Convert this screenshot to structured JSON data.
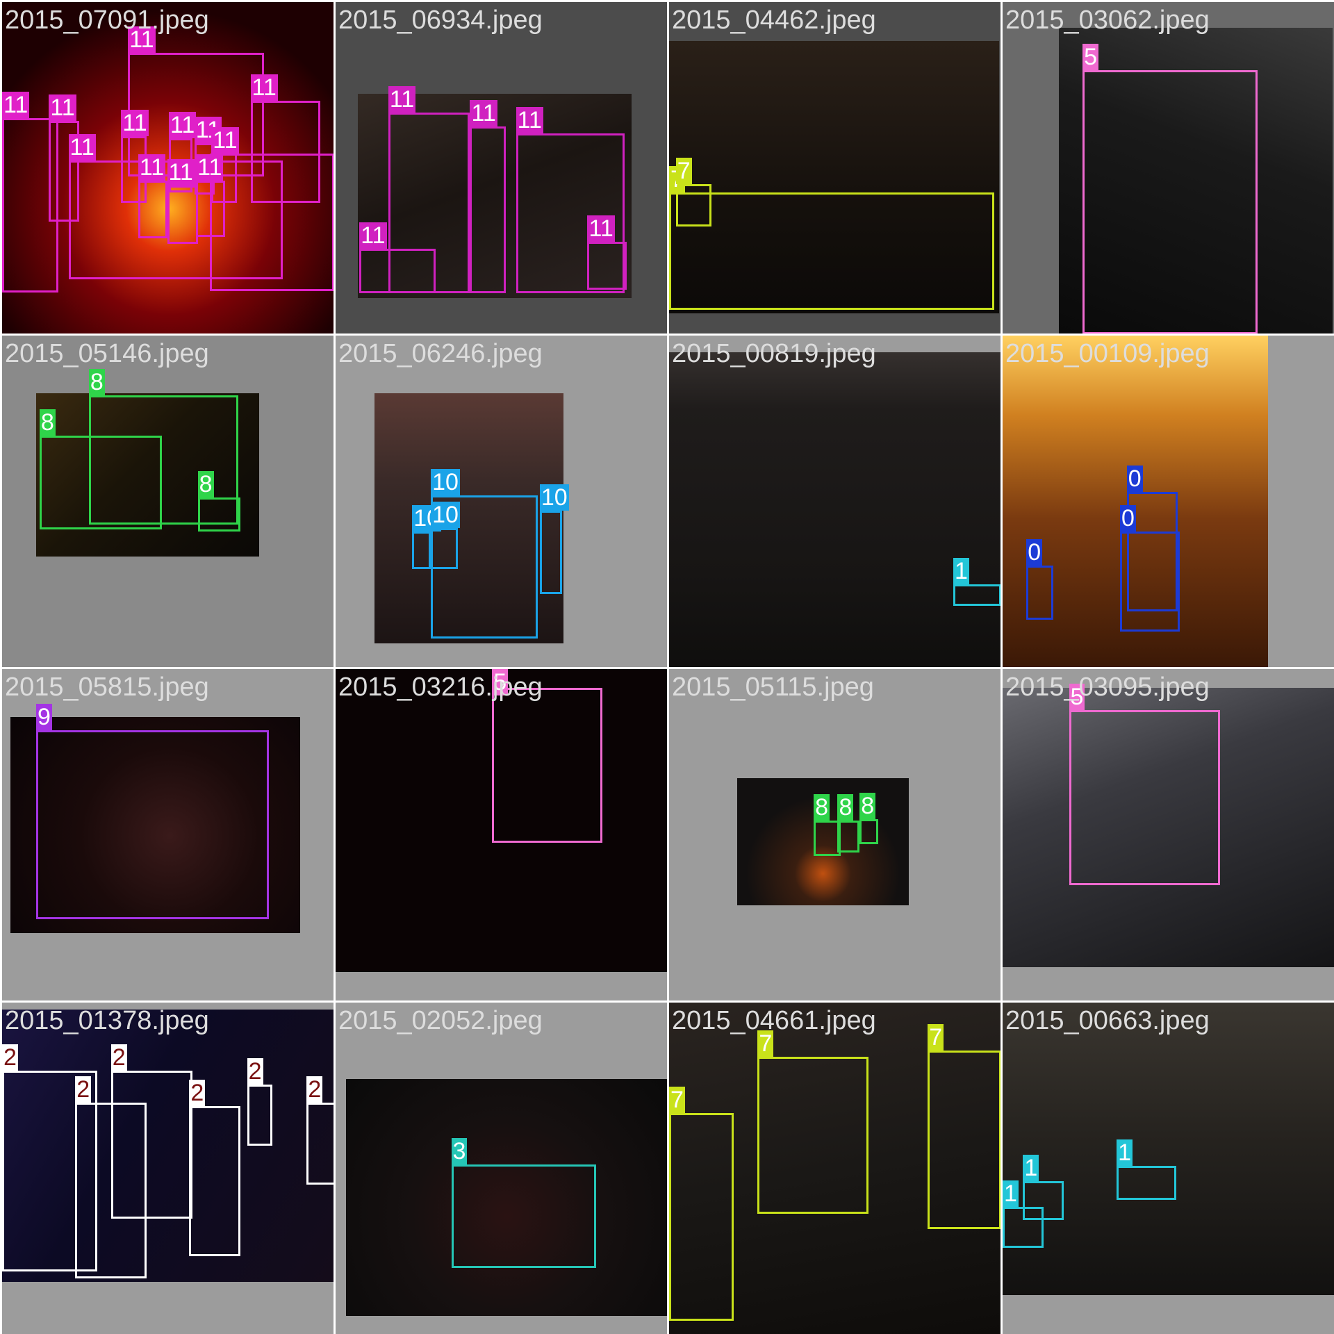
{
  "tiles": [
    {
      "filename": "2015_07091.jpeg",
      "bg": "#9a9a9a",
      "photo": {
        "bg": "radial-gradient(circle at 50% 62%, #ffb020 0%, #e03008 16%, #7a0206 40%, #1e0002 75%)"
      },
      "boxes": [
        {
          "l": 148,
          "t": 60,
          "w": 160,
          "h": 145,
          "label": "11",
          "color": "#e020c8",
          "text": "#ffffff"
        },
        {
          "l": 0,
          "t": 136,
          "w": 66,
          "h": 205,
          "label": "11",
          "color": "#e020c8",
          "text": "#ffffff"
        },
        {
          "l": 55,
          "t": 140,
          "w": 36,
          "h": 118,
          "label": "11",
          "color": "#e020c8",
          "text": "#ffffff"
        },
        {
          "l": 292,
          "t": 116,
          "w": 82,
          "h": 120,
          "label": "11",
          "color": "#e020c8",
          "text": "#ffffff"
        },
        {
          "l": 140,
          "t": 158,
          "w": 30,
          "h": 78,
          "label": "11",
          "color": "#e020c8",
          "text": "#ffffff"
        },
        {
          "l": 196,
          "t": 160,
          "w": 28,
          "h": 64,
          "label": "11",
          "color": "#e020c8",
          "text": "#ffffff"
        },
        {
          "l": 226,
          "t": 166,
          "w": 24,
          "h": 60,
          "label": "11",
          "color": "#e020c8",
          "text": "#ffffff"
        },
        {
          "l": 246,
          "t": 178,
          "w": 30,
          "h": 58,
          "label": "11",
          "color": "#e020c8",
          "text": "#ffffff"
        },
        {
          "l": 78,
          "t": 186,
          "w": 252,
          "h": 140,
          "label": "11",
          "color": "#e020c8",
          "text": "#ffffff"
        },
        {
          "l": 160,
          "t": 210,
          "w": 34,
          "h": 68,
          "label": "11",
          "color": "#e020c8",
          "text": "#ffffff"
        },
        {
          "l": 194,
          "t": 216,
          "w": 36,
          "h": 68,
          "label": "11",
          "color": "#e020c8",
          "text": "#ffffff"
        },
        {
          "l": 228,
          "t": 210,
          "w": 34,
          "h": 66,
          "label": "11",
          "color": "#e020c8",
          "text": "#ffffff"
        },
        {
          "l": 244,
          "t": 178,
          "w": 146,
          "h": 162,
          "label": "",
          "color": "#e020c8",
          "text": "#ffffff"
        }
      ]
    },
    {
      "filename": "2015_06934.jpeg",
      "bg": "#4c4c4c",
      "photo": {
        "l": 26,
        "t": 108,
        "w": 322,
        "h": 240,
        "bg": "linear-gradient(160deg, #342a24 0%, #1b1512 45%, #2a2220 100%)"
      },
      "boxes": [
        {
          "l": 62,
          "t": 130,
          "w": 96,
          "h": 212,
          "label": "11",
          "color": "#d021c0",
          "text": "#ffffff"
        },
        {
          "l": 158,
          "t": 146,
          "w": 42,
          "h": 196,
          "label": "11",
          "color": "#d021c0",
          "text": "#ffffff"
        },
        {
          "l": 212,
          "t": 154,
          "w": 128,
          "h": 188,
          "label": "11",
          "color": "#d021c0",
          "text": "#ffffff"
        },
        {
          "l": 28,
          "t": 290,
          "w": 90,
          "h": 52,
          "label": "11",
          "color": "#d021c0",
          "text": "#ffffff"
        },
        {
          "l": 296,
          "t": 282,
          "w": 46,
          "h": 56,
          "label": "11",
          "color": "#d021c0",
          "text": "#ffffff"
        }
      ]
    },
    {
      "filename": "2015_04462.jpeg",
      "bg": "#4c4c4c",
      "photo": {
        "l": 0,
        "t": 46,
        "w": 388,
        "h": 320,
        "bg": "linear-gradient(180deg, #2a2018 0%, #16110d 55%, #0c0a08 100%)"
      },
      "boxes": [
        {
          "l": 0,
          "t": 224,
          "w": 382,
          "h": 138,
          "label": "7",
          "color": "#c9e21a",
          "text": "#ffffff"
        },
        {
          "l": 8,
          "t": 214,
          "w": 42,
          "h": 50,
          "label": "7",
          "color": "#c9e21a",
          "text": "#ffffff"
        }
      ]
    },
    {
      "filename": "2015_03062.jpeg",
      "bg": "#6a6a6a",
      "photo": {
        "l": 66,
        "t": 30,
        "w": 322,
        "h": 360,
        "bg": "linear-gradient(200deg, #3a3a3a 0%, #1a1a1a 40%, #0a0a0a 100%)"
      },
      "boxes": [
        {
          "l": 94,
          "t": 80,
          "w": 206,
          "h": 310,
          "label": "5",
          "color": "#ef6ad0",
          "text": "#ffffff"
        }
      ]
    },
    {
      "filename": "2015_05146.jpeg",
      "bg": "#8a8a8a",
      "photo": {
        "l": 40,
        "t": 68,
        "w": 262,
        "h": 192,
        "bg": "linear-gradient(135deg, #3a2a10 0%, #1a1408 45%, #0a0806 100%)"
      },
      "boxes": [
        {
          "l": 102,
          "t": 70,
          "w": 176,
          "h": 152,
          "label": "8",
          "color": "#2fd44a",
          "text": "#ffffff"
        },
        {
          "l": 44,
          "t": 118,
          "w": 144,
          "h": 110,
          "label": "8",
          "color": "#2fd44a",
          "text": "#ffffff"
        },
        {
          "l": 230,
          "t": 190,
          "w": 50,
          "h": 40,
          "label": "8",
          "color": "#2fd44a",
          "text": "#ffffff"
        }
      ]
    },
    {
      "filename": "2015_06246.jpeg",
      "bg": "#9c9c9c",
      "photo": {
        "l": 46,
        "t": 68,
        "w": 222,
        "h": 294,
        "bg": "linear-gradient(180deg, #5a3a34 0%, #3a2a28 35%, #1c1414 100%)"
      },
      "boxes": [
        {
          "l": 112,
          "t": 188,
          "w": 126,
          "h": 168,
          "label": "10",
          "color": "#1aa3e8",
          "text": "#ffffff"
        },
        {
          "l": 240,
          "t": 206,
          "w": 26,
          "h": 98,
          "label": "10",
          "color": "#1aa3e8",
          "text": "#ffffff"
        },
        {
          "l": 90,
          "t": 230,
          "w": 22,
          "h": 44,
          "label": "10",
          "color": "#1aa3e8",
          "text": "#ffffff"
        },
        {
          "l": 112,
          "t": 226,
          "w": 32,
          "h": 48,
          "label": "10",
          "color": "#1aa3e8",
          "text": "#ffffff"
        }
      ]
    },
    {
      "filename": "2015_00819.jpeg",
      "bg": "#9c9c9c",
      "photo": {
        "l": 0,
        "t": 20,
        "w": 390,
        "h": 372,
        "bg": "linear-gradient(180deg, #35302e 0%, #1f1c1b 18%, #171514 70%, #0f0e0d 100%)"
      },
      "boxes": [
        {
          "l": 334,
          "t": 292,
          "w": 56,
          "h": 26,
          "label": "1",
          "color": "#23c6d8",
          "text": "#ffffff"
        }
      ]
    },
    {
      "filename": "2015_00109.jpeg",
      "bg": "#9c9c9c",
      "photo": {
        "l": 0,
        "t": 0,
        "w": 312,
        "h": 392,
        "bg": "linear-gradient(180deg, #ffd060 0%, #d08020 24%, #7a3a10 55%, #3a1806 100%)"
      },
      "boxes": [
        {
          "l": 146,
          "t": 184,
          "w": 60,
          "h": 140,
          "label": "0",
          "color": "#1c3bd6",
          "text": "#ffffff"
        },
        {
          "l": 138,
          "t": 230,
          "w": 70,
          "h": 118,
          "label": "0",
          "color": "#1c3bd6",
          "text": "#ffffff"
        },
        {
          "l": 28,
          "t": 270,
          "w": 32,
          "h": 64,
          "label": "0",
          "color": "#1c3bd6",
          "text": "#ffffff"
        }
      ]
    },
    {
      "filename": "2015_05815.jpeg",
      "bg": "#9c9c9c",
      "photo": {
        "l": 10,
        "t": 56,
        "w": 340,
        "h": 254,
        "bg": "radial-gradient(circle at 55% 55%, #3a1a1a 0%, #1a0a0a 45%, #0a0406 100%)"
      },
      "boxes": [
        {
          "l": 40,
          "t": 72,
          "w": 274,
          "h": 222,
          "label": "9",
          "color": "#a434e4",
          "text": "#ffffff"
        }
      ]
    },
    {
      "filename": "2015_03216.jpeg",
      "bg": "#9c9c9c",
      "photo": {
        "l": 0,
        "t": 0,
        "w": 390,
        "h": 356,
        "bg": "#0a0304"
      },
      "boxes": [
        {
          "l": 184,
          "t": 22,
          "w": 130,
          "h": 182,
          "label": "5",
          "color": "#ef6ad0",
          "text": "#ffffff"
        }
      ]
    },
    {
      "filename": "2015_05115.jpeg",
      "bg": "#9c9c9c",
      "photo": {
        "l": 80,
        "t": 128,
        "w": 202,
        "h": 150,
        "bg": "radial-gradient(circle at 50% 75%, #c05010 0%, #3a1e10 22%, #121010 60%)"
      },
      "boxes": [
        {
          "l": 170,
          "t": 178,
          "w": 32,
          "h": 42,
          "label": "8",
          "color": "#2fd44a",
          "text": "#ffffff"
        },
        {
          "l": 198,
          "t": 178,
          "w": 26,
          "h": 38,
          "label": "8",
          "color": "#2fd44a",
          "text": "#ffffff"
        },
        {
          "l": 224,
          "t": 176,
          "w": 22,
          "h": 30,
          "label": "8",
          "color": "#2fd44a",
          "text": "#ffffff"
        }
      ]
    },
    {
      "filename": "2015_03095.jpeg",
      "bg": "#9c9c9c",
      "photo": {
        "l": 0,
        "t": 22,
        "w": 390,
        "h": 328,
        "bg": "linear-gradient(160deg, #6a6a70 0%, #3a3a40 35%, #141416 100%)"
      },
      "boxes": [
        {
          "l": 78,
          "t": 48,
          "w": 178,
          "h": 206,
          "label": "5",
          "color": "#ef6ad0",
          "text": "#ffffff"
        }
      ]
    },
    {
      "filename": "2015_01378.jpeg",
      "bg": "#9c9c9c",
      "photo": {
        "l": 0,
        "t": 8,
        "w": 392,
        "h": 320,
        "bg": "linear-gradient(120deg, #1a1440 0%, #0c0a24 40%, #140c1a 100%)"
      },
      "boxes": [
        {
          "l": 0,
          "t": 80,
          "w": 112,
          "h": 236,
          "label": "2",
          "color": "#ffffff",
          "text": "#7a1212"
        },
        {
          "l": 86,
          "t": 118,
          "w": 84,
          "h": 206,
          "label": "2",
          "color": "#ffffff",
          "text": "#7a1212"
        },
        {
          "l": 128,
          "t": 80,
          "w": 96,
          "h": 174,
          "label": "2",
          "color": "#ffffff",
          "text": "#7a1212"
        },
        {
          "l": 220,
          "t": 122,
          "w": 60,
          "h": 176,
          "label": "2",
          "color": "#ffffff",
          "text": "#7a1212"
        },
        {
          "l": 288,
          "t": 96,
          "w": 30,
          "h": 72,
          "label": "2",
          "color": "#ffffff",
          "text": "#7a1212"
        },
        {
          "l": 358,
          "t": 118,
          "w": 34,
          "h": 96,
          "label": "2",
          "color": "#ffffff",
          "text": "#7a1212"
        }
      ]
    },
    {
      "filename": "2015_02052.jpeg",
      "bg": "#9c9c9c",
      "photo": {
        "l": 12,
        "t": 90,
        "w": 378,
        "h": 278,
        "bg": "radial-gradient(circle at 50% 58%, #2a1212 0%, #161010 45%, #0a0a0a 100%)"
      },
      "boxes": [
        {
          "l": 136,
          "t": 190,
          "w": 170,
          "h": 122,
          "label": "3",
          "color": "#25c6b6",
          "text": "#ffffff"
        }
      ]
    },
    {
      "filename": "2015_04661.jpeg",
      "bg": "#9c9c9c",
      "photo": {
        "l": 0,
        "t": 0,
        "w": 392,
        "h": 392,
        "bg": "linear-gradient(170deg, #2a2420 0%, #1a1816 50%, #0e0c0a 100%)"
      },
      "boxes": [
        {
          "l": 104,
          "t": 64,
          "w": 130,
          "h": 184,
          "label": "7",
          "color": "#c9e21a",
          "text": "#ffffff"
        },
        {
          "l": 304,
          "t": 56,
          "w": 86,
          "h": 210,
          "label": "7",
          "color": "#c9e21a",
          "text": "#ffffff"
        },
        {
          "l": 0,
          "t": 130,
          "w": 76,
          "h": 244,
          "label": "7",
          "color": "#c9e21a",
          "text": "#ffffff"
        }
      ]
    },
    {
      "filename": "2015_00663.jpeg",
      "bg": "#9c9c9c",
      "photo": {
        "l": 0,
        "t": 0,
        "w": 390,
        "h": 344,
        "bg": "linear-gradient(180deg, #3a3630 0%, #26231f 45%, #121110 100%)"
      },
      "boxes": [
        {
          "l": 134,
          "t": 192,
          "w": 70,
          "h": 40,
          "label": "1",
          "color": "#23c6d8",
          "text": "#ffffff"
        },
        {
          "l": 24,
          "t": 210,
          "w": 48,
          "h": 46,
          "label": "1",
          "color": "#23c6d8",
          "text": "#ffffff"
        },
        {
          "l": 0,
          "t": 240,
          "w": 48,
          "h": 48,
          "label": "1",
          "color": "#23c6d8",
          "text": "#ffffff"
        }
      ]
    }
  ]
}
